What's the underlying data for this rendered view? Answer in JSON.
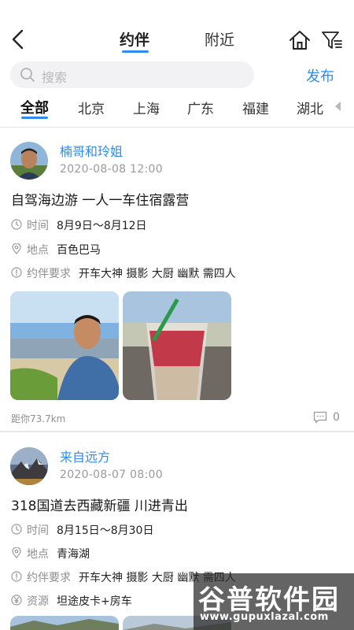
{
  "header": {
    "tabs": [
      {
        "label": "约伴",
        "active": true
      },
      {
        "label": "附近",
        "active": false
      }
    ],
    "accent_color": "#2e8cf0"
  },
  "search": {
    "placeholder": "搜索"
  },
  "publish_label": "发布",
  "categories": [
    "全部",
    "北京",
    "上海",
    "广东",
    "福建",
    "湖北"
  ],
  "posts": [
    {
      "user": "楠哥和玲姐",
      "date": "2020-08-08 12:00",
      "title": "自驾海边游 一人一车住宿露营",
      "time_label": "时间",
      "time_value": "8月9日～8月12日",
      "place_label": "地点",
      "place_value": "百色巴马",
      "req_label": "约伴要求",
      "req_value": "开车大神 摄影 大厨 幽默 需四人",
      "distance": "距你73.7km",
      "comments": "0"
    },
    {
      "user": "来自远方",
      "date": "2020-08-07 08:00",
      "title": "318国道去西藏新疆 川进青出",
      "time_label": "时间",
      "time_value": "8月15日～8月30日",
      "place_label": "地点",
      "place_value": "青海湖",
      "req_label": "约伴要求",
      "req_value": "开车大神 摄影 大厨 幽默 需四人",
      "res_label": "资源",
      "res_value": "坦途皮卡+房车"
    }
  ],
  "watermark": {
    "title": "谷普软件园",
    "url": "www.gupuxlazal.com"
  }
}
